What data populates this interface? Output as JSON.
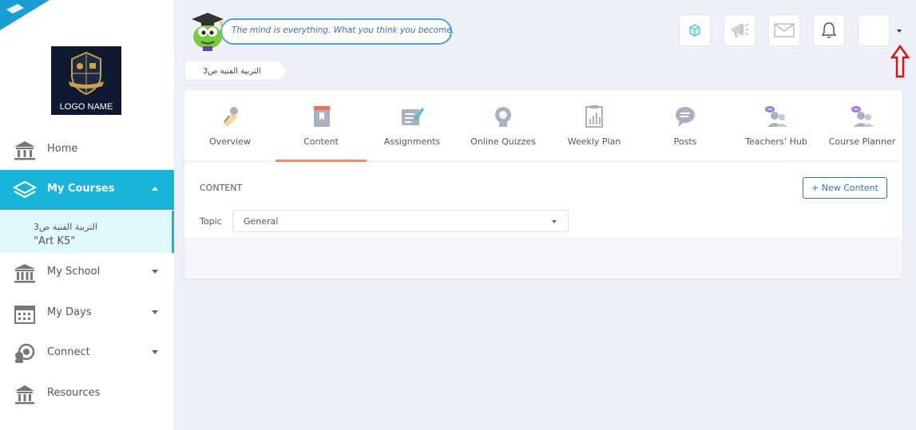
{
  "sidebar": {
    "logo_text": "LOGO NAME",
    "items": [
      {
        "label": "Home",
        "icon": "home-building-icon"
      },
      {
        "label": "My Courses",
        "icon": "stack-layers-icon"
      },
      {
        "label": "My School",
        "icon": "school-building-icon"
      },
      {
        "label": "My Days",
        "icon": "calendar-icon"
      },
      {
        "label": "Connect",
        "icon": "connect-users-icon"
      },
      {
        "label": "Resources",
        "icon": "library-building-icon"
      }
    ],
    "sub_item": {
      "line1": "التربية الفنية ص3",
      "line2": "\"Art K5\""
    }
  },
  "header": {
    "quote": "The mind is everything. What you think you become.",
    "buttons": [
      "puzzle-cube-icon",
      "megaphone-icon",
      "envelope-icon",
      "bell-icon",
      "user-avatar"
    ]
  },
  "breadcrumb": "التربية الفنية ص3",
  "tabs": [
    {
      "label": "Overview",
      "icon": "overview-pin-icon"
    },
    {
      "label": "Content",
      "icon": "book-icon"
    },
    {
      "label": "Assignments",
      "icon": "assignment-pen-icon"
    },
    {
      "label": "Online Quizzes",
      "icon": "quiz-head-icon"
    },
    {
      "label": "Weekly Plan",
      "icon": "clipboard-chart-icon"
    },
    {
      "label": "Posts",
      "icon": "speech-bubble-icon"
    },
    {
      "label": "Teachers’ Hub",
      "icon": "teachers-chat-icon"
    },
    {
      "label": "Course Planner",
      "icon": "planner-users-icon"
    }
  ],
  "active_tab": "Content",
  "content": {
    "heading": "CONTENT",
    "new_button": "+ New Content",
    "topic_label": "Topic",
    "topic_value": "General"
  },
  "colors": {
    "accent": "#17b3d8",
    "tab_underline": "#f08a6c",
    "button_blue": "#2f72b8",
    "arrow_red": "#e01010"
  }
}
